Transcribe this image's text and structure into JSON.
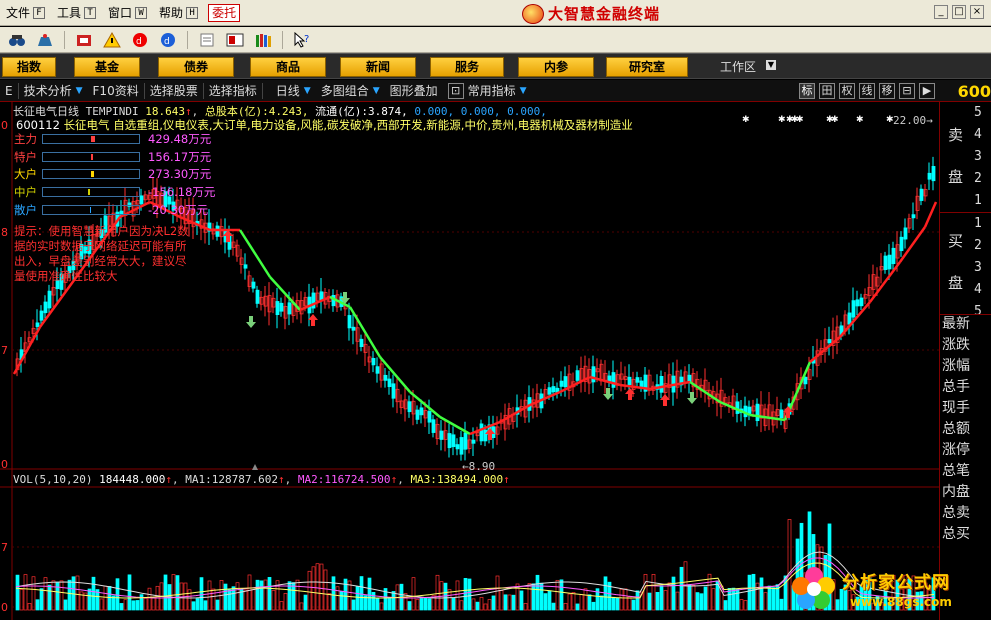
{
  "menubar": {
    "items": [
      {
        "label": "文件",
        "key": "F"
      },
      {
        "label": "工具",
        "key": "T"
      },
      {
        "label": "窗口",
        "key": "W"
      },
      {
        "label": "帮助",
        "key": "H"
      }
    ],
    "weituo_label": "委托",
    "brand_title": "大智慧金融终端",
    "window_controls": [
      "_",
      "□",
      "×"
    ]
  },
  "toolbar": {
    "icons": [
      "binoculars-icon",
      "alarm-icon",
      "tool-red-icon",
      "warning-icon",
      "red-disc-icon",
      "blue-disc-icon",
      "document-icon",
      "screen-icon",
      "books-icon",
      "help-pointer-icon"
    ],
    "help_label": "?"
  },
  "nav": {
    "buttons": [
      "指数",
      "基金",
      "债券",
      "商品",
      "新闻",
      "服务",
      "内参",
      "研究室"
    ],
    "workspace_label": "工作区",
    "workspace_arrow": "▼"
  },
  "funcbar": {
    "items": [
      "技术分析",
      "F10资料",
      "选择股票",
      "选择指标",
      "日线",
      "多图组合",
      "图形叠加",
      "常用指标"
    ],
    "first_label": "E",
    "icons": [
      "标",
      "田",
      "权",
      "线",
      "移",
      "⊟",
      "▶"
    ],
    "stock_code_top": "600"
  },
  "chart": {
    "stock_name": "长征电气",
    "period": "日线",
    "indicator": "TEMPINDI",
    "value1": "18.643",
    "shares_label": "总股本(亿):",
    "shares_value": "4.243,",
    "float_label": "流通(亿):",
    "float_value": "3.874,",
    "extra_values": "0.000, 0.000, 0.000,",
    "concept_code": "600112",
    "concept_text": "长征电气 自选重组,仪电仪表,大订单,电力设备,风能,碳发破净,西部开发,新能源,中价,贵州,电器机械及器材制造业",
    "fund_rows": [
      {
        "label": "主力",
        "value": "429.48万元",
        "color": "#ff4040"
      },
      {
        "label": "特户",
        "value": "156.17万元",
        "color": "#ff4040"
      },
      {
        "label": "大户",
        "value": "273.30万元",
        "color": "#ffd700"
      },
      {
        "label": "中户",
        "value": "-156.18万元",
        "color": "#d0d000"
      },
      {
        "label": "散户",
        "value": "-20 30万元",
        "color": "#2aa5ff"
      }
    ],
    "tip_text": "提示：使用智慧新用户因为决L2数据的实时数据于网络延迟可能有所出入，早盘差别经常大大，建议尽量使用准确性比较大",
    "low_price_label": "←8.90",
    "high_price_label": "22.00→",
    "vol_label": "VOL(5,10,20)",
    "vol_value": "184448.000",
    "ma1_label": "MA1:",
    "ma1_value": "128787.602",
    "ma2_label": "MA2:",
    "ma2_value": "116724.500",
    "ma3_label": "MA3:",
    "ma3_value": "138494.000",
    "y_ticks": [
      "0",
      "8",
      "7",
      "0",
      "7",
      "0"
    ],
    "colors": {
      "up": "#ff3030",
      "down": "#00ffff",
      "ma_up": "#ff2020",
      "ma_down": "#40ff40",
      "yellow": "#ffff66",
      "magenta": "#ff5aff"
    }
  },
  "sidebar": {
    "sell_label": [
      "卖",
      "盘"
    ],
    "sell_nums": [
      "5",
      "4",
      "3",
      "2",
      "1"
    ],
    "buy_label": [
      "买",
      "盘"
    ],
    "buy_nums": [
      "1",
      "2",
      "3",
      "4",
      "5"
    ],
    "tabs": [
      "最新",
      "涨跌",
      "涨幅",
      "总手",
      "现手",
      "总额",
      "涨停",
      "总笔",
      "内盘",
      "总卖",
      "总买"
    ]
  },
  "watermark": {
    "title": "分析家公式网",
    "url": "www.88gs.com"
  }
}
